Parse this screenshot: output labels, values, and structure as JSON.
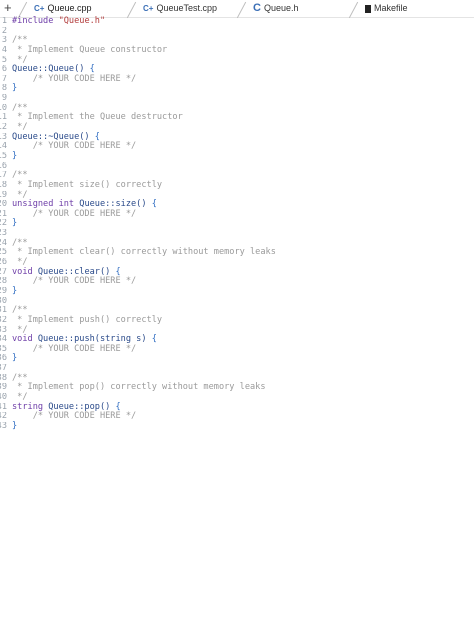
{
  "tabs": [
    {
      "label": "Queue.cpp",
      "icon": "cpp-file-icon",
      "active": true
    },
    {
      "label": "QueueTest.cpp",
      "icon": "cpp-file-icon",
      "active": false
    },
    {
      "label": "Queue.h",
      "icon": "c-header-icon",
      "active": false
    },
    {
      "label": "Makefile",
      "icon": "makefile-icon",
      "active": false
    }
  ],
  "add_tab_label": "+",
  "icon_glyphs": {
    "cpp": "C+",
    "c": "C"
  },
  "lines": [
    {
      "n": "1",
      "code": [
        [
          "kw",
          "#include "
        ],
        [
          "str",
          "\"Queue.h\""
        ]
      ]
    },
    {
      "n": "2",
      "code": []
    },
    {
      "n": "3",
      "code": [
        [
          "comment",
          "/**"
        ]
      ]
    },
    {
      "n": "4",
      "code": [
        [
          "comment",
          " * Implement Queue constructor"
        ]
      ]
    },
    {
      "n": "5",
      "code": [
        [
          "comment",
          " */"
        ]
      ]
    },
    {
      "n": "6",
      "code": [
        [
          "fn",
          "Queue::Queue() "
        ],
        [
          "br",
          "{"
        ]
      ]
    },
    {
      "n": "7",
      "code": [
        [
          "comment",
          "    /* YOUR CODE HERE */"
        ]
      ]
    },
    {
      "n": "8",
      "code": [
        [
          "br",
          "}"
        ]
      ]
    },
    {
      "n": "9",
      "code": []
    },
    {
      "n": "10",
      "code": [
        [
          "comment",
          "/**"
        ]
      ]
    },
    {
      "n": "11",
      "code": [
        [
          "comment",
          " * Implement the Queue destructor"
        ]
      ]
    },
    {
      "n": "12",
      "code": [
        [
          "comment",
          " */"
        ]
      ]
    },
    {
      "n": "13",
      "code": [
        [
          "fn",
          "Queue::~Queue() "
        ],
        [
          "br",
          "{"
        ]
      ]
    },
    {
      "n": "14",
      "code": [
        [
          "comment",
          "    /* YOUR CODE HERE */"
        ]
      ]
    },
    {
      "n": "15",
      "code": [
        [
          "br",
          "}"
        ]
      ]
    },
    {
      "n": "16",
      "code": []
    },
    {
      "n": "17",
      "code": [
        [
          "comment",
          "/**"
        ]
      ]
    },
    {
      "n": "18",
      "code": [
        [
          "comment",
          " * Implement size() correctly"
        ]
      ]
    },
    {
      "n": "19",
      "code": [
        [
          "comment",
          " */"
        ]
      ]
    },
    {
      "n": "20",
      "code": [
        [
          "kw",
          "unsigned int "
        ],
        [
          "fn",
          "Queue::size() "
        ],
        [
          "br",
          "{"
        ]
      ]
    },
    {
      "n": "21",
      "code": [
        [
          "comment",
          "    /* YOUR CODE HERE */"
        ]
      ]
    },
    {
      "n": "22",
      "code": [
        [
          "br",
          "}"
        ]
      ]
    },
    {
      "n": "23",
      "code": []
    },
    {
      "n": "24",
      "code": [
        [
          "comment",
          "/**"
        ]
      ]
    },
    {
      "n": "25",
      "code": [
        [
          "comment",
          " * Implement clear() correctly without memory leaks"
        ]
      ]
    },
    {
      "n": "26",
      "code": [
        [
          "comment",
          " */"
        ]
      ]
    },
    {
      "n": "27",
      "code": [
        [
          "kw",
          "void "
        ],
        [
          "fn",
          "Queue::clear() "
        ],
        [
          "br",
          "{"
        ]
      ]
    },
    {
      "n": "28",
      "code": [
        [
          "comment",
          "    /* YOUR CODE HERE */"
        ]
      ]
    },
    {
      "n": "29",
      "code": [
        [
          "br",
          "}"
        ]
      ]
    },
    {
      "n": "30",
      "code": []
    },
    {
      "n": "31",
      "code": [
        [
          "comment",
          "/**"
        ]
      ]
    },
    {
      "n": "32",
      "code": [
        [
          "comment",
          " * Implement push() correctly"
        ]
      ]
    },
    {
      "n": "33",
      "code": [
        [
          "comment",
          " */"
        ]
      ]
    },
    {
      "n": "34",
      "code": [
        [
          "kw",
          "void "
        ],
        [
          "fn",
          "Queue::push(string s) "
        ],
        [
          "br",
          "{"
        ]
      ]
    },
    {
      "n": "35",
      "code": [
        [
          "comment",
          "    /* YOUR CODE HERE */"
        ]
      ]
    },
    {
      "n": "36",
      "code": [
        [
          "br",
          "}"
        ]
      ]
    },
    {
      "n": "37",
      "code": []
    },
    {
      "n": "38",
      "code": [
        [
          "comment",
          "/**"
        ]
      ]
    },
    {
      "n": "39",
      "code": [
        [
          "comment",
          " * Implement pop() correctly without memory leaks"
        ]
      ]
    },
    {
      "n": "40",
      "code": [
        [
          "comment",
          " */"
        ]
      ]
    },
    {
      "n": "41",
      "code": [
        [
          "kw",
          "string "
        ],
        [
          "fn",
          "Queue::pop() "
        ],
        [
          "br",
          "{"
        ]
      ]
    },
    {
      "n": "42",
      "code": [
        [
          "comment",
          "    /* YOUR CODE HERE */"
        ]
      ]
    },
    {
      "n": "43",
      "code": [
        [
          "br",
          "}"
        ]
      ]
    }
  ]
}
